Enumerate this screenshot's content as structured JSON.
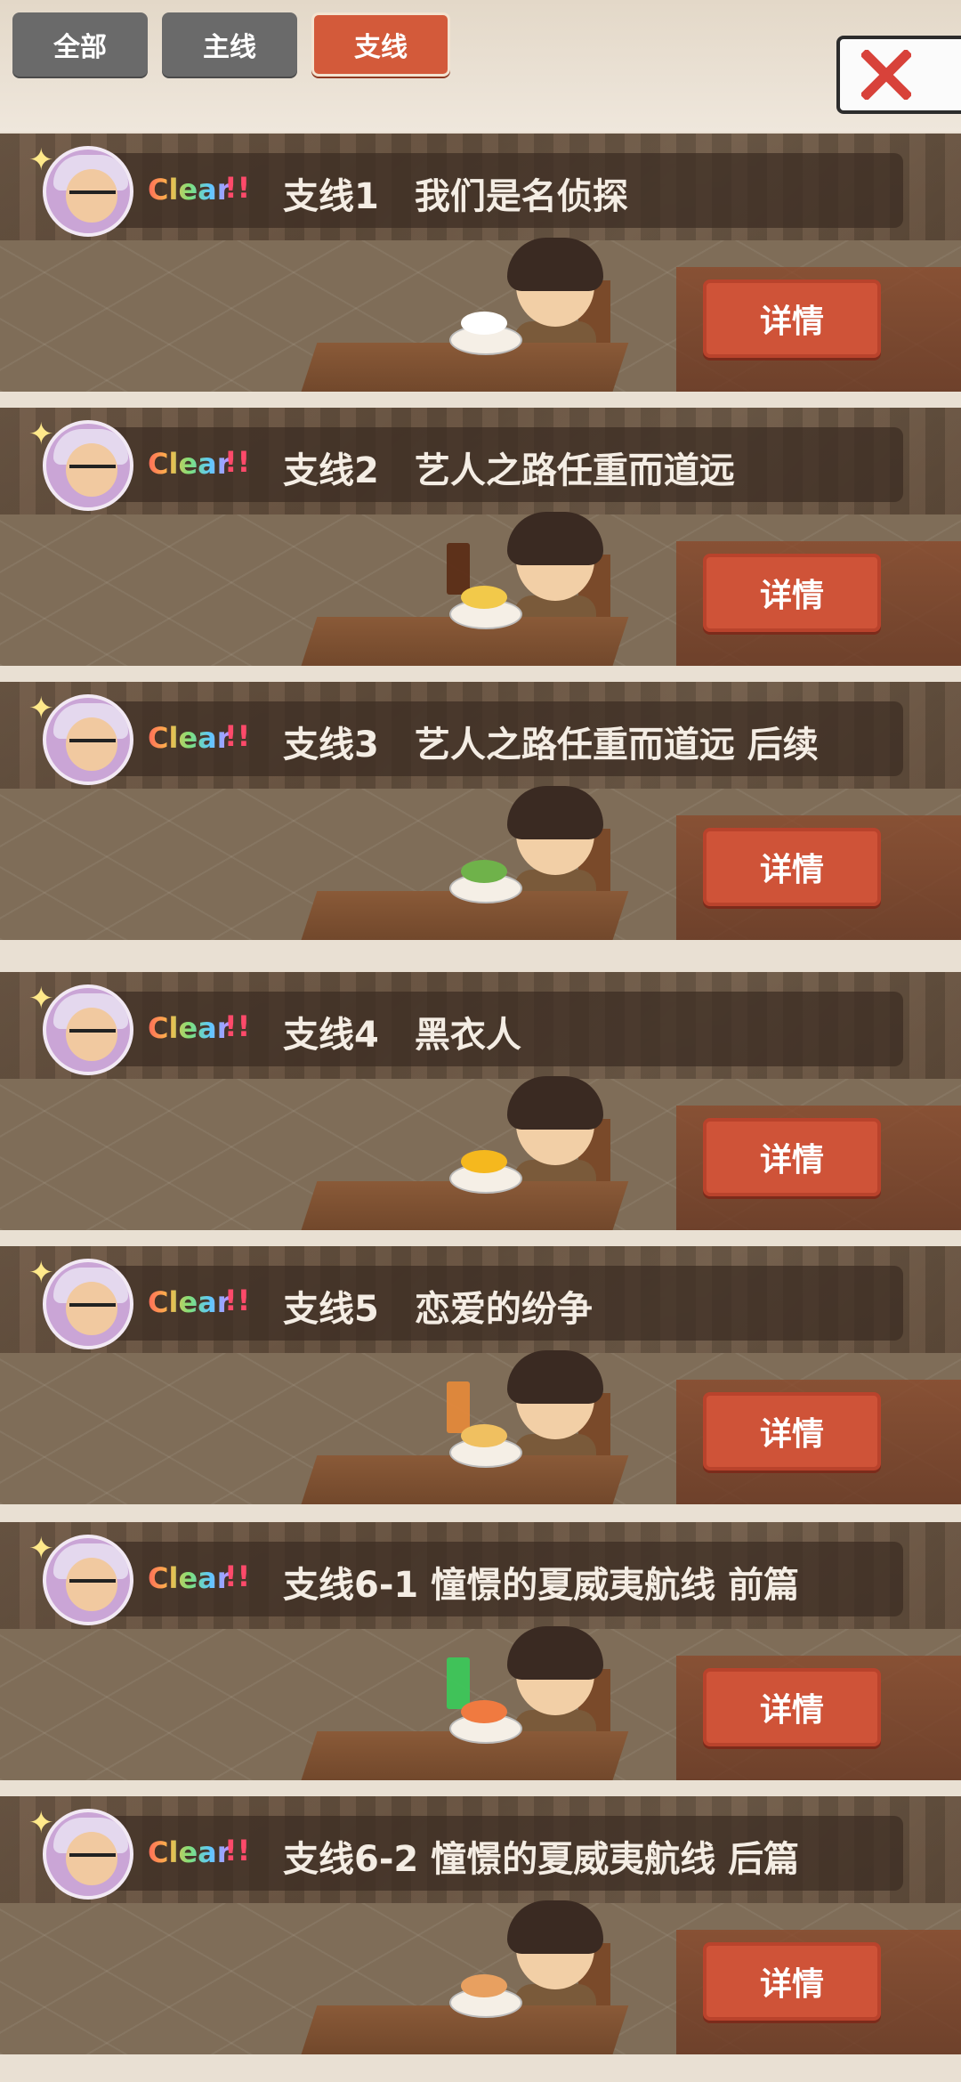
{
  "tabs": [
    {
      "label": "全部",
      "active": false
    },
    {
      "label": "主线",
      "active": false
    },
    {
      "label": "支线",
      "active": true
    }
  ],
  "close_icon": "close-x-icon",
  "colors": {
    "accent": "#d35a3a",
    "tab_inactive": "#6a6a6a",
    "detail_button": "#cf5338"
  },
  "stories": [
    {
      "status": "Clear",
      "status_mark": "!!",
      "title": "支线1　我们是名侦探",
      "detail_label": "详情",
      "food": "rice-bowl",
      "drink": ""
    },
    {
      "status": "Clear",
      "status_mark": "!!",
      "title": "支线2　艺人之路任重而道远",
      "detail_label": "详情",
      "food": "fried-rice",
      "drink": "cola"
    },
    {
      "status": "Clear",
      "status_mark": "!!",
      "title": "支线3　艺人之路任重而道远 后续",
      "detail_label": "详情",
      "food": "salad",
      "drink": ""
    },
    {
      "status": "Clear",
      "status_mark": "!!",
      "title": "支线4　黑衣人",
      "detail_label": "详情",
      "food": "omelette-rice",
      "drink": ""
    },
    {
      "status": "Clear",
      "status_mark": "!!",
      "title": "支线5　恋爱的纷争",
      "detail_label": "详情",
      "food": "soup",
      "drink": "juice"
    },
    {
      "status": "Clear",
      "status_mark": "!!",
      "title": "支线6-1 憧憬的夏威夷航线 前篇",
      "detail_label": "详情",
      "food": "shrimp",
      "drink": "melon-soda"
    },
    {
      "status": "Clear",
      "status_mark": "!!",
      "title": "支线6-2 憧憬的夏威夷航线 后篇",
      "detail_label": "详情",
      "food": "ramen",
      "drink": ""
    }
  ]
}
